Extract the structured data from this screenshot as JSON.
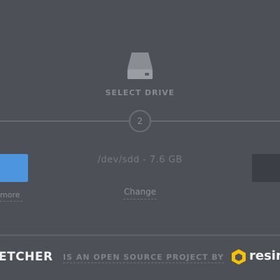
{
  "drive_step": {
    "icon": "hard-drive-icon",
    "title": "SELECT DRIVE",
    "step_number": "2",
    "selected_drive": "/dev/sdd - 7.6 GB",
    "change_label": "Change"
  },
  "image_step": {
    "more_label": "more"
  },
  "footer": {
    "brand": "ETCHER",
    "tagline": "IS AN OPEN SOURCE PROJECT BY",
    "company_logo_icon": "resin-cube-icon",
    "company": "resin.i"
  },
  "colors": {
    "background": "#4d5057",
    "accent_blue": "#4e95e0",
    "logo_yellow": "#f6c200"
  }
}
